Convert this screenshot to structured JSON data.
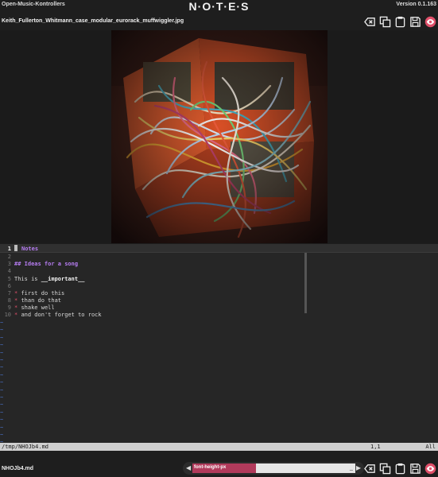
{
  "header": {
    "brand": "Open-Music-Kontrollers",
    "title": "N·O·T·E·S",
    "version": "Version 0.1.163"
  },
  "file": {
    "name": "Keith_Fullerton_Whitmann_case_modular_eurorack_muffwiggler.jpg"
  },
  "toolbar": {
    "icons": [
      "clear-icon",
      "copy-icon",
      "paste-icon",
      "save-icon",
      "preview-eye-icon"
    ],
    "eye_color": "#e0506a"
  },
  "editor": {
    "lines": [
      {
        "num": "1",
        "text": "Notes"
      },
      {
        "num": "2",
        "text": ""
      },
      {
        "num": "3",
        "text": "## Ideas for a song"
      },
      {
        "num": "4",
        "text": ""
      },
      {
        "num": "5",
        "prefix": "This is ",
        "emph": "__important__"
      },
      {
        "num": "6",
        "text": ""
      },
      {
        "num": "7",
        "bullet": "*",
        "text": "first do this"
      },
      {
        "num": "8",
        "bullet": "*",
        "text": "than do that"
      },
      {
        "num": "9",
        "bullet": "*",
        "text": "shake well"
      },
      {
        "num": "10",
        "bullet": "*",
        "text": "and don't forget to rock"
      }
    ],
    "empty_marker": "~"
  },
  "status": {
    "path": "/tmp/NHOJb4.md",
    "position": "1,1",
    "scroll": "All"
  },
  "footer": {
    "file": "NHOJb4.md",
    "control_label": "font-height-px",
    "control_fraction": 0.39,
    "left_arrow": "◀",
    "right_arrow": "▶",
    "underscore": "_"
  }
}
